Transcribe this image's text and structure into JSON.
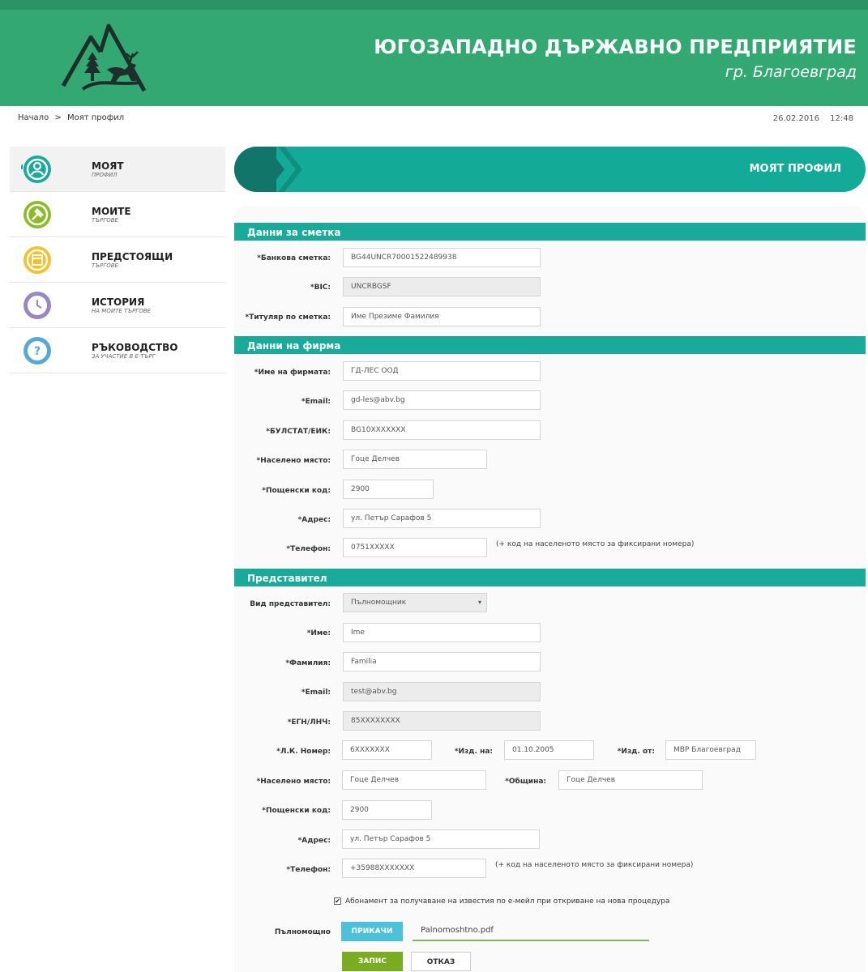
{
  "header": {
    "org_title": "ЮГОЗАПАДНО ДЪРЖАВНО ПРЕДПРИЯТИЕ",
    "org_city": "гр. Благоевград",
    "brand_color": "#34a872"
  },
  "breadcrumb": {
    "home": "Начало",
    "separator": ">",
    "current": "Моят профил"
  },
  "datetime": {
    "date": "26.02.2016",
    "time": "12:48"
  },
  "sidebar": {
    "items": [
      {
        "title": "МОЯТ",
        "sub": "ПРОФИЛ",
        "icon": "user-icon",
        "color": "#1aa99a",
        "active": true
      },
      {
        "title": "МОИТЕ",
        "sub": "ТЪРГОВЕ",
        "icon": "gavel-icon",
        "color": "#8bbb2a",
        "active": false
      },
      {
        "title": "ПРЕДСТОЯЩИ",
        "sub": "ТЪРГОВЕ",
        "icon": "calendar-icon",
        "color": "#f3c22a",
        "active": false
      },
      {
        "title": "ИСТОРИЯ",
        "sub": "НА МОИТЕ ТЪРГОВЕ",
        "icon": "clock-icon",
        "color": "#9a86c2",
        "active": false
      },
      {
        "title": "РЪКОВОДСТВО",
        "sub": "ЗА УЧАСТИЕ В Е-ТЪРГ",
        "icon": "question-icon",
        "color": "#5aa6d4",
        "active": false
      }
    ]
  },
  "page_title": "МОЯТ ПРОФИЛ",
  "sections": {
    "account": "Данни за сметка",
    "company": "Данни на фирма",
    "representative": "Представител"
  },
  "account": {
    "bank_label": "*Банкова сметка:",
    "bank_value": "BG44UNCR70001522489938",
    "bic_label": "*BIC:",
    "bic_value": "UNCRBGSF",
    "holder_label": "*Титуляр по сметка:",
    "holder_value": "Име Презиме Фамилия"
  },
  "company": {
    "name_label": "*Име на фирмата:",
    "name_value": "ГД-ЛЕС ООД",
    "email_label": "*Email:",
    "email_value": "gd-les@abv.bg",
    "bulstat_label": "*БУЛСТАТ/ЕИК:",
    "bulstat_value": "BG10XXXXXXX",
    "city_label": "*Населено място:",
    "city_value": "Гоце Делчев",
    "zip_label": "*Пощенски код:",
    "zip_value": "2900",
    "address_label": "*Адрес:",
    "address_value": "ул. Петър Сарафов 5",
    "phone_label": "*Телефон:",
    "phone_value": "0751XXXXX",
    "phone_hint": "(+ код на населеното място за фиксирани номера)"
  },
  "representative": {
    "type_label": "Вид представител:",
    "type_value": "Пълномощник",
    "first_label": "*Име:",
    "first_value": "Ime",
    "last_label": "*Фамилия:",
    "last_value": "Familia",
    "email_label": "*Email:",
    "email_value": "test@abv.bg",
    "egn_label": "*ЕГН/ЛНЧ:",
    "egn_value": "85XXXXXXXX",
    "id_label": "*Л.К. Номер:",
    "id_value": "6XXXXXXX",
    "issued_on_label": "*Изд. на:",
    "issued_on_value": "01.10.2005",
    "issued_by_label": "*Изд. от:",
    "issued_by_value": "МВР Благоевград",
    "city_label": "*Населено място:",
    "city_value": "Гоце Делчев",
    "municipality_label": "*Община:",
    "municipality_value": "Гоце Делчев",
    "zip_label": "*Пощенски код:",
    "zip_value": "2900",
    "address_label": "*Адрес:",
    "address_value": "ул. Петър Сарафов 5",
    "phone_label": "*Телефон:",
    "phone_value": "+35988XXXXXXX",
    "phone_hint": "(+ код на населеното място за фиксирани номера)"
  },
  "subscribe": {
    "checked": "✔",
    "text": "Абонамент за получаване на известия по е-мейл при откриване на нова процедура"
  },
  "attachment": {
    "label": "Пълномощно",
    "button": "ПРИКАЧИ",
    "file": "Palnomoshtno.pdf"
  },
  "actions": {
    "save": "ЗАПИС",
    "cancel": "ОТКАЗ"
  }
}
